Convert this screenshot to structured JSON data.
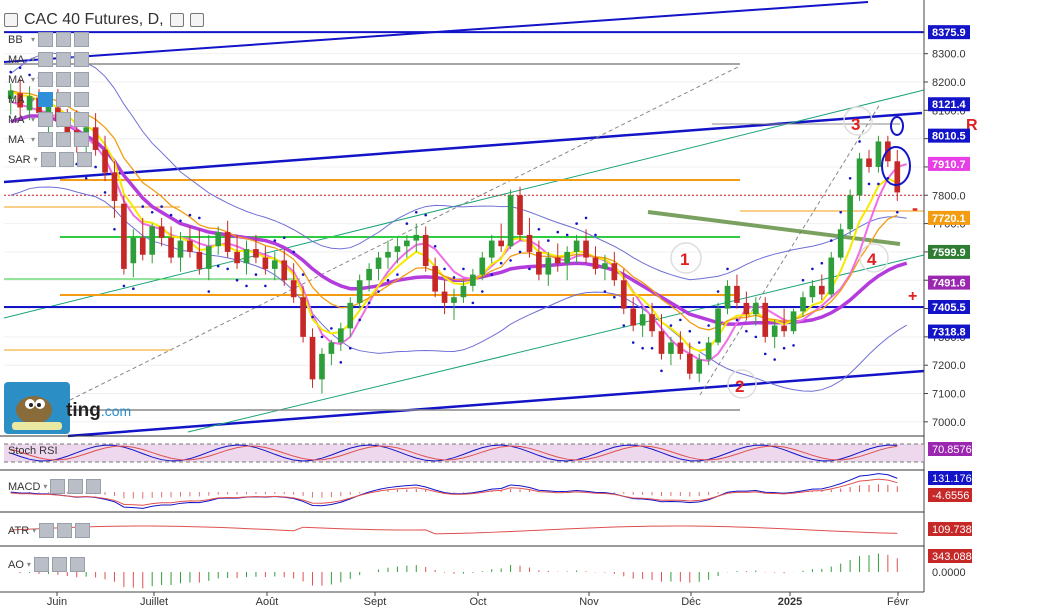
{
  "header": {
    "title": "CAC 40 Futures, D,"
  },
  "indicators": [
    {
      "label": "BB"
    },
    {
      "label": "MA"
    },
    {
      "label": "MA"
    },
    {
      "label": "MA"
    },
    {
      "label": "MA"
    },
    {
      "label": "MA"
    },
    {
      "label": "SAR"
    }
  ],
  "panels": {
    "stoch": {
      "label": "Stoch RSI",
      "values": [
        "70.8576"
      ]
    },
    "macd": {
      "label": "MACD",
      "values": [
        "131.1768",
        "-4.6556"
      ]
    },
    "atr": {
      "label": "ATR",
      "values": [
        "109.7381"
      ]
    },
    "ao": {
      "label": "AO",
      "values": [
        "343.0883",
        "0.0000"
      ]
    }
  },
  "logo": {
    "text": "ting",
    "suffix": ".com"
  },
  "annotations": {
    "wave1": "1",
    "wave2": "2",
    "wave3": "3",
    "wave4": "4",
    "r": "R",
    "plus": "+",
    "minus": "-"
  },
  "colors": {
    "up": "#2e9e3a",
    "down": "#c62828",
    "blue": "#1313c8",
    "orange": "#f39c12",
    "green": "#2ecc40",
    "magenta": "#d94fd9",
    "yellow": "#f5e900"
  },
  "chart_data": {
    "type": "candlestick",
    "title": "CAC 40 Futures, D,",
    "x_ticks": [
      "Juin",
      "Juillet",
      "Août",
      "Sept",
      "Oct",
      "Nov",
      "Déc",
      "2025",
      "Févr"
    ],
    "y_ticks": [
      "8300.0",
      "8200.0",
      "8100.0",
      "8000.0",
      "7900.0",
      "7800.0",
      "7700.0",
      "7600.0",
      "7500.0",
      "7400.0",
      "7300.0",
      "7200.0",
      "7100.0",
      "7000.0"
    ],
    "ylim": [
      6950,
      8440
    ],
    "price_labels": [
      {
        "text": "8375.9",
        "value": 8375.9,
        "bg": "#1313c8",
        "fg": "#ffffff"
      },
      {
        "text": "8121.4",
        "value": 8121.4,
        "bg": "#1313c8",
        "fg": "#ffffff"
      },
      {
        "text": "8010.5",
        "value": 8010.5,
        "bg": "#1313c8",
        "fg": "#ffffff"
      },
      {
        "text": "7910.7",
        "value": 7910.7,
        "bg": "#e83ee8",
        "fg": "#ffffff"
      },
      {
        "text": "7720.1",
        "value": 7720.1,
        "bg": "#f39c12",
        "fg": "#ffffff"
      },
      {
        "text": "7599.9",
        "value": 7599.9,
        "bg": "#2e7d32",
        "fg": "#ffffff"
      },
      {
        "text": "7491.6",
        "value": 7491.6,
        "bg": "#9b27b0",
        "fg": "#ffffff"
      },
      {
        "text": "7405.5",
        "value": 7405.5,
        "bg": "#1313c8",
        "fg": "#ffffff"
      },
      {
        "text": "7318.8",
        "value": 7318.8,
        "bg": "#1313c8",
        "fg": "#ffffff"
      }
    ],
    "horizontal_levels": [
      {
        "value": 8375.9,
        "color": "#1313c8"
      },
      {
        "value": 7800,
        "color": "#c62828"
      },
      {
        "value": 7405.5,
        "color": "#1313c8"
      }
    ],
    "candles": [
      [
        8140,
        8195,
        8085,
        8170
      ],
      [
        8160,
        8210,
        8080,
        8110
      ],
      [
        8100,
        8185,
        8065,
        8150
      ],
      [
        8145,
        8175,
        8060,
        8090
      ],
      [
        8090,
        8150,
        8020,
        8120
      ],
      [
        8110,
        8175,
        8040,
        8060
      ],
      [
        8050,
        8105,
        7980,
        8020
      ],
      [
        8030,
        8100,
        7950,
        7980
      ],
      [
        7980,
        8070,
        7900,
        8040
      ],
      [
        8040,
        8090,
        7940,
        7960
      ],
      [
        7960,
        8010,
        7850,
        7880
      ],
      [
        7880,
        7920,
        7720,
        7780
      ],
      [
        7770,
        7800,
        7520,
        7540
      ],
      [
        7560,
        7680,
        7510,
        7650
      ],
      [
        7650,
        7720,
        7570,
        7590
      ],
      [
        7590,
        7700,
        7560,
        7690
      ],
      [
        7690,
        7720,
        7620,
        7650
      ],
      [
        7650,
        7690,
        7560,
        7580
      ],
      [
        7580,
        7670,
        7530,
        7640
      ],
      [
        7640,
        7690,
        7580,
        7600
      ],
      [
        7600,
        7680,
        7520,
        7540
      ],
      [
        7540,
        7660,
        7500,
        7620
      ],
      [
        7620,
        7690,
        7590,
        7670
      ],
      [
        7670,
        7710,
        7580,
        7600
      ],
      [
        7600,
        7660,
        7540,
        7560
      ],
      [
        7560,
        7640,
        7520,
        7610
      ],
      [
        7610,
        7660,
        7560,
        7580
      ],
      [
        7580,
        7620,
        7520,
        7540
      ],
      [
        7540,
        7600,
        7500,
        7570
      ],
      [
        7570,
        7610,
        7480,
        7500
      ],
      [
        7500,
        7560,
        7420,
        7440
      ],
      [
        7440,
        7480,
        7280,
        7300
      ],
      [
        7300,
        7330,
        7120,
        7150
      ],
      [
        7150,
        7260,
        7100,
        7240
      ],
      [
        7240,
        7290,
        7200,
        7280
      ],
      [
        7280,
        7350,
        7250,
        7330
      ],
      [
        7330,
        7440,
        7300,
        7420
      ],
      [
        7420,
        7520,
        7400,
        7500
      ],
      [
        7500,
        7560,
        7460,
        7540
      ],
      [
        7540,
        7600,
        7500,
        7580
      ],
      [
        7580,
        7640,
        7540,
        7600
      ],
      [
        7600,
        7650,
        7560,
        7620
      ],
      [
        7620,
        7660,
        7580,
        7640
      ],
      [
        7640,
        7700,
        7600,
        7660
      ],
      [
        7660,
        7690,
        7530,
        7550
      ],
      [
        7550,
        7580,
        7440,
        7460
      ],
      [
        7460,
        7500,
        7380,
        7420
      ],
      [
        7420,
        7470,
        7360,
        7440
      ],
      [
        7440,
        7500,
        7420,
        7480
      ],
      [
        7480,
        7540,
        7460,
        7520
      ],
      [
        7520,
        7600,
        7500,
        7580
      ],
      [
        7580,
        7660,
        7560,
        7640
      ],
      [
        7640,
        7700,
        7600,
        7620
      ],
      [
        7620,
        7820,
        7610,
        7800
      ],
      [
        7800,
        7830,
        7640,
        7660
      ],
      [
        7660,
        7720,
        7580,
        7600
      ],
      [
        7600,
        7640,
        7500,
        7520
      ],
      [
        7520,
        7600,
        7480,
        7580
      ],
      [
        7580,
        7630,
        7530,
        7560
      ],
      [
        7560,
        7620,
        7500,
        7600
      ],
      [
        7600,
        7660,
        7560,
        7640
      ],
      [
        7640,
        7680,
        7560,
        7580
      ],
      [
        7580,
        7620,
        7520,
        7540
      ],
      [
        7540,
        7590,
        7500,
        7560
      ],
      [
        7560,
        7600,
        7480,
        7500
      ],
      [
        7500,
        7540,
        7380,
        7400
      ],
      [
        7400,
        7440,
        7320,
        7340
      ],
      [
        7340,
        7400,
        7300,
        7380
      ],
      [
        7380,
        7420,
        7300,
        7320
      ],
      [
        7320,
        7380,
        7220,
        7240
      ],
      [
        7240,
        7300,
        7200,
        7280
      ],
      [
        7280,
        7320,
        7220,
        7240
      ],
      [
        7240,
        7280,
        7150,
        7170
      ],
      [
        7170,
        7240,
        7140,
        7220
      ],
      [
        7220,
        7300,
        7200,
        7280
      ],
      [
        7280,
        7420,
        7270,
        7400
      ],
      [
        7400,
        7500,
        7380,
        7480
      ],
      [
        7480,
        7520,
        7400,
        7420
      ],
      [
        7420,
        7460,
        7360,
        7380
      ],
      [
        7380,
        7440,
        7340,
        7420
      ],
      [
        7420,
        7440,
        7280,
        7300
      ],
      [
        7300,
        7360,
        7260,
        7340
      ],
      [
        7340,
        7400,
        7300,
        7320
      ],
      [
        7320,
        7400,
        7310,
        7390
      ],
      [
        7390,
        7460,
        7370,
        7440
      ],
      [
        7440,
        7500,
        7420,
        7480
      ],
      [
        7480,
        7520,
        7430,
        7450
      ],
      [
        7450,
        7600,
        7440,
        7580
      ],
      [
        7580,
        7700,
        7570,
        7680
      ],
      [
        7680,
        7820,
        7660,
        7800
      ],
      [
        7800,
        7950,
        7780,
        7930
      ],
      [
        7930,
        7960,
        7880,
        7900
      ],
      [
        7900,
        8010,
        7880,
        7990
      ],
      [
        7990,
        8010,
        7900,
        7920
      ],
      [
        7920,
        7960,
        7780,
        7810
      ]
    ],
    "series": [
      {
        "name": "MA",
        "values": [
          8060,
          8070,
          8080,
          8080,
          8075,
          8065,
          8050,
          8030,
          8010,
          7990,
          7960,
          7920,
          7870,
          7830,
          7790,
          7760,
          7740,
          7720,
          7700,
          7690,
          7680,
          7670,
          7665,
          7660,
          7655,
          7650,
          7645,
          7640,
          7630,
          7615,
          7595,
          7570,
          7540,
          7515,
          7495,
          7480,
          7470,
          7470,
          7475,
          7480,
          7490,
          7500,
          7505,
          7510,
          7512,
          7510,
          7505,
          7500,
          7500,
          7505,
          7512,
          7520,
          7528,
          7540,
          7545,
          7548,
          7550,
          7552,
          7555,
          7558,
          7560,
          7558,
          7552,
          7545,
          7535,
          7520,
          7500,
          7480,
          7460,
          7440,
          7420,
          7400,
          7380,
          7370,
          7360,
          7350,
          7345,
          7345,
          7348,
          7350,
          7350,
          7350,
          7350,
          7352,
          7355,
          7360,
          7370,
          7385,
          7405,
          7430,
          7460,
          7490,
          7515,
          7535,
          7550,
          7560
        ]
      },
      {
        "name": "MA",
        "values": [
          8130,
          8120,
          8110,
          8100,
          8090,
          8075,
          8055,
          8030,
          8005,
          7975,
          7930,
          7860,
          7780,
          7730,
          7700,
          7690,
          7680,
          7660,
          7650,
          7645,
          7630,
          7620,
          7625,
          7630,
          7620,
          7605,
          7600,
          7590,
          7575,
          7560,
          7530,
          7470,
          7380,
          7310,
          7280,
          7275,
          7300,
          7360,
          7420,
          7480,
          7530,
          7570,
          7600,
          7625,
          7630,
          7610,
          7570,
          7530,
          7510,
          7505,
          7520,
          7550,
          7580,
          7620,
          7640,
          7640,
          7620,
          7590,
          7575,
          7570,
          7585,
          7590,
          7580,
          7570,
          7550,
          7510,
          7460,
          7410,
          7370,
          7330,
          7290,
          7260,
          7240,
          7220,
          7215,
          7240,
          7290,
          7350,
          7400,
          7410,
          7400,
          7380,
          7360,
          7350,
          7360,
          7385,
          7410,
          7440,
          7470,
          7520,
          7600,
          7700,
          7790,
          7860,
          7900,
          7910
        ]
      }
    ],
    "sub_panels": [
      "Stoch RSI",
      "MACD",
      "ATR",
      "AO"
    ]
  }
}
